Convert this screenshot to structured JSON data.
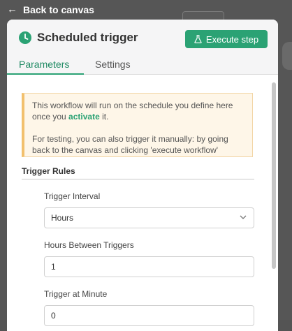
{
  "nav": {
    "back_label": "Back to canvas",
    "back_icon": "arrow-left-icon"
  },
  "node": {
    "title": "Scheduled trigger",
    "icon": "clock-icon",
    "execute_label": "Execute step",
    "execute_icon": "flask-icon"
  },
  "tabs": {
    "parameters": "Parameters",
    "settings": "Settings",
    "active": "Parameters"
  },
  "notice": {
    "line1_before": "This workflow will run on the schedule you define here once you ",
    "line1_link": "activate",
    "line1_after": " it.",
    "line2": "For testing, you can also trigger it manually: by going back to the canvas and clicking 'execute workflow'"
  },
  "rules": {
    "section_title": "Trigger Rules",
    "interval_label": "Trigger Interval",
    "interval_value": "Hours",
    "hours_between_label": "Hours Between Triggers",
    "hours_between_value": "1",
    "minute_label": "Trigger at Minute",
    "minute_value": "0"
  },
  "colors": {
    "accent": "#2ba274",
    "notice_border": "#f2c06d",
    "notice_bg": "#fef6e8"
  }
}
